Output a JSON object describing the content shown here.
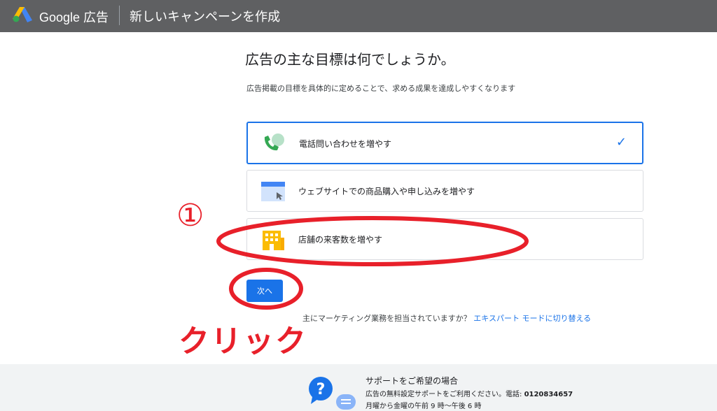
{
  "header": {
    "brand": "Google 広告",
    "page_title": "新しいキャンペーンを作成"
  },
  "main": {
    "heading": "広告の主な目標は何でしょうか。",
    "subtext": "広告掲載の目標を具体的に定めることで、求める成果を達成しやすくなります",
    "options": [
      {
        "label": "電話問い合わせを増やす",
        "icon": "phone-icon",
        "selected": true
      },
      {
        "label": "ウェブサイトでの商品購入や申し込みを増やす",
        "icon": "website-icon",
        "selected": false
      },
      {
        "label": "店舗の来客数を増やす",
        "icon": "store-icon",
        "selected": false
      }
    ],
    "next_button": "次へ",
    "marketing_question": "主にマーケティング業務を担当されていますか？",
    "expert_link": "エキスパート モードに切り替える"
  },
  "annotations": {
    "number": "①",
    "click_text": "クリック",
    "color": "#e8202a"
  },
  "footer": {
    "title": "サポートをご希望の場合",
    "line1_prefix": "広告の無料設定サポートをご利用ください。電話: ",
    "phone": "0120834657",
    "line2": "月曜から金曜の午前 9 時～午後 6 時"
  },
  "colors": {
    "accent": "#1a73e8",
    "topbar": "#5f6062"
  }
}
